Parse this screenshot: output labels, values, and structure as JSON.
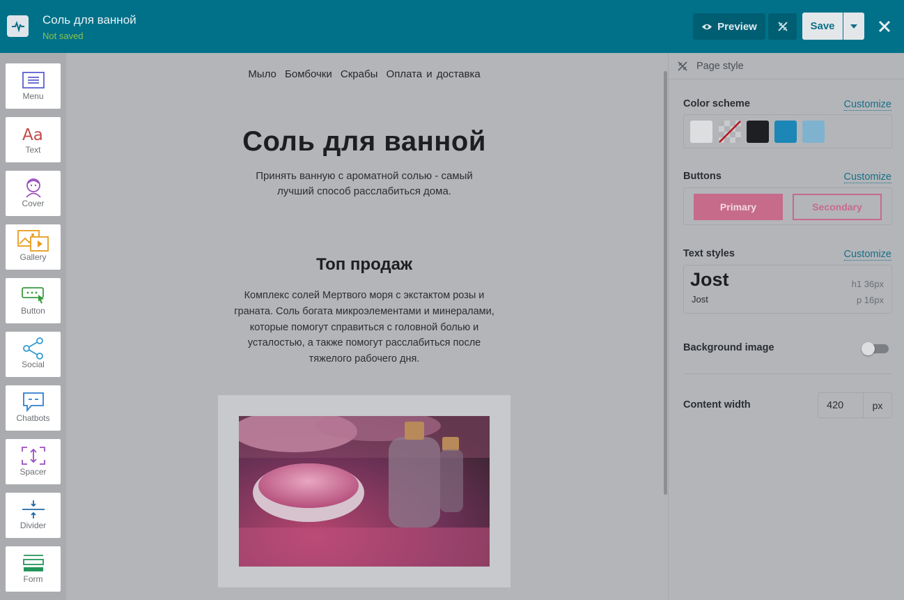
{
  "topbar": {
    "title": "Соль для ванной",
    "status": "Not saved",
    "preview_label": "Preview",
    "save_label": "Save",
    "colors": {
      "bar": "#007189",
      "status": "#8bc34a"
    }
  },
  "palette": {
    "items": [
      {
        "label": "Menu",
        "icon": "menu-icon"
      },
      {
        "label": "Text",
        "icon": "text-icon"
      },
      {
        "label": "Cover",
        "icon": "cover-icon"
      },
      {
        "label": "Gallery",
        "icon": "gallery-icon"
      },
      {
        "label": "Button",
        "icon": "button-icon"
      },
      {
        "label": "Social",
        "icon": "social-icon"
      },
      {
        "label": "Chatbots",
        "icon": "chatbots-icon"
      },
      {
        "label": "Spacer",
        "icon": "spacer-icon"
      },
      {
        "label": "Divider",
        "icon": "divider-icon"
      },
      {
        "label": "Form",
        "icon": "form-icon"
      }
    ]
  },
  "canvas": {
    "nav": [
      "Мыло",
      "Бомбочки",
      "Скрабы",
      "Оплата и доставка"
    ],
    "hero_title": "Соль для ванной",
    "hero_subtitle": "Принять ванную с ароматной солью - самый лучший способ расслабиться дома.",
    "section_title": "Топ продаж",
    "section_text": "Комплекс солей Мертвого моря с экстактом розы и граната. Соль богата микроэлементами и минералами, которые помогут справиться с головной болью и усталостью, а также помогут расслабиться после тяжелого рабочего дня."
  },
  "panel": {
    "header": "Page style",
    "color_scheme": {
      "label": "Color scheme",
      "customize": "Customize",
      "swatches": [
        "#dcdee0",
        "transparent",
        "#1e1f22",
        "#1c86b6",
        "#7fb2cf"
      ]
    },
    "buttons": {
      "label": "Buttons",
      "customize": "Customize",
      "primary": "Primary",
      "secondary": "Secondary",
      "accent": "#c66b8a"
    },
    "text_styles": {
      "label": "Text styles",
      "customize": "Customize",
      "h1_font": "Jost",
      "p_font": "Jost",
      "h1_meta": "h1  36px",
      "p_meta": "p  16px"
    },
    "background_image": {
      "label": "Background image",
      "enabled": false
    },
    "content_width": {
      "label": "Content width",
      "value": "420",
      "unit": "px"
    }
  }
}
